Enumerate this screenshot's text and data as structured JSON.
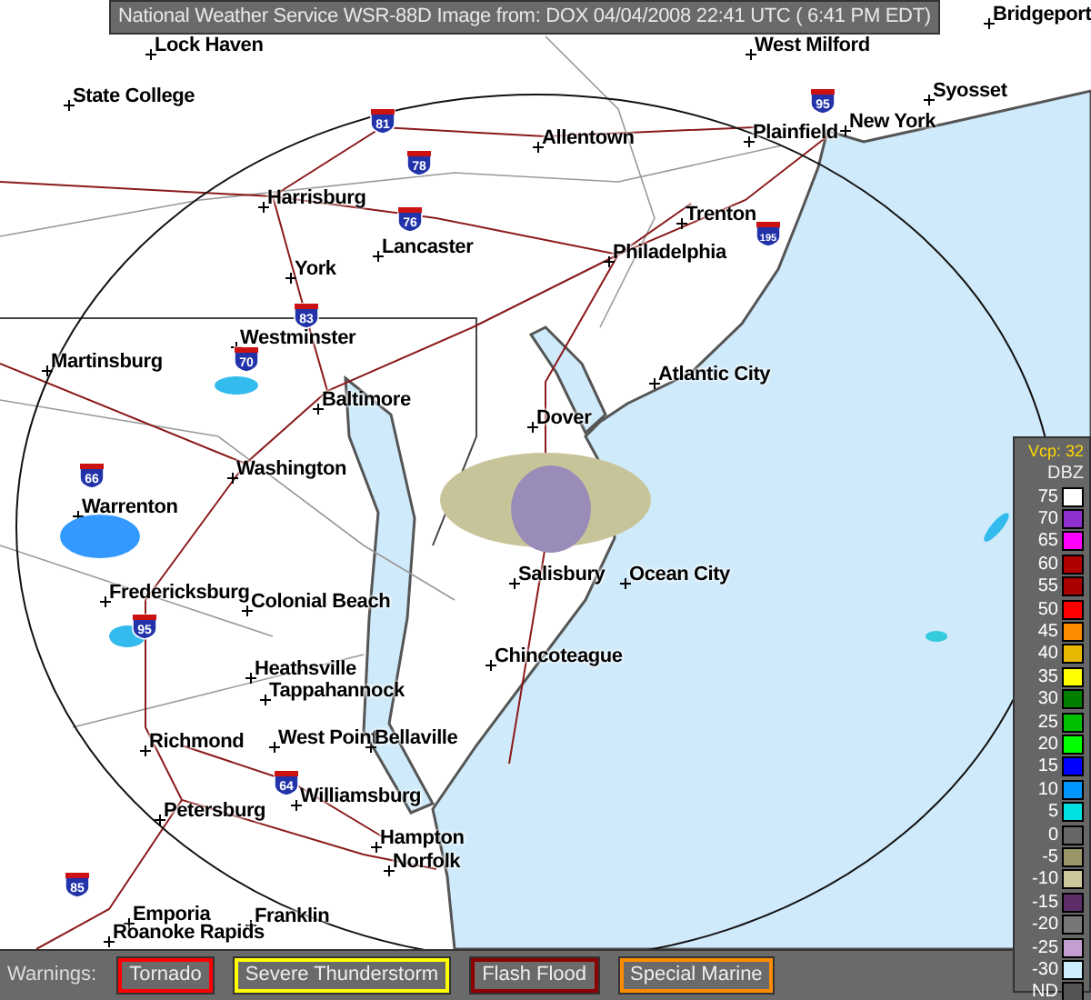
{
  "header": {
    "title": "National Weather Service WSR-88D Image from: DOX 04/04/2008 22:41 UTC ( 6:41 PM EDT)"
  },
  "map": {
    "cities": [
      {
        "name": "Lock Haven"
      },
      {
        "name": "State College"
      },
      {
        "name": "West Milford"
      },
      {
        "name": "Bridgeport"
      },
      {
        "name": "Syosset"
      },
      {
        "name": "New York"
      },
      {
        "name": "Plainfield"
      },
      {
        "name": "Allentown"
      },
      {
        "name": "Harrisburg"
      },
      {
        "name": "Trenton"
      },
      {
        "name": "Lancaster"
      },
      {
        "name": "Philadelphia"
      },
      {
        "name": "York"
      },
      {
        "name": "Westminster"
      },
      {
        "name": "Martinsburg"
      },
      {
        "name": "Baltimore"
      },
      {
        "name": "Atlantic City"
      },
      {
        "name": "Dover"
      },
      {
        "name": "Washington"
      },
      {
        "name": "Warrenton"
      },
      {
        "name": "Salisbury"
      },
      {
        "name": "Ocean City"
      },
      {
        "name": "Fredericksburg"
      },
      {
        "name": "Colonial Beach"
      },
      {
        "name": "Chincoteague"
      },
      {
        "name": "Heathsville"
      },
      {
        "name": "Tappahannock"
      },
      {
        "name": "Richmond"
      },
      {
        "name": "West Point"
      },
      {
        "name": "Bellaville"
      },
      {
        "name": "Williamsburg"
      },
      {
        "name": "Petersburg"
      },
      {
        "name": "Hampton"
      },
      {
        "name": "Norfolk"
      },
      {
        "name": "Emporia"
      },
      {
        "name": "Franklin"
      },
      {
        "name": "Roanoke Rapids"
      }
    ],
    "interstates": [
      {
        "label": "81"
      },
      {
        "label": "78"
      },
      {
        "label": "76"
      },
      {
        "label": "83"
      },
      {
        "label": "95"
      },
      {
        "label": "195"
      },
      {
        "label": "70"
      },
      {
        "label": "66"
      },
      {
        "label": "95"
      },
      {
        "label": "64"
      },
      {
        "label": "85"
      }
    ]
  },
  "legend": {
    "vcp": "Vcp: 32",
    "unit": "DBZ",
    "levels": [
      {
        "label": "75",
        "color": "#ffffff"
      },
      {
        "label": "70",
        "color": "#8e2fd0"
      },
      {
        "label": "65",
        "color": "#ff00ff"
      },
      {
        "label": "60",
        "color": "#b00000"
      },
      {
        "label": "55",
        "color": "#a80000"
      },
      {
        "label": "50",
        "color": "#ff0000"
      },
      {
        "label": "45",
        "color": "#ff8c00"
      },
      {
        "label": "40",
        "color": "#e8b800"
      },
      {
        "label": "35",
        "color": "#ffff00"
      },
      {
        "label": "30",
        "color": "#008000"
      },
      {
        "label": "25",
        "color": "#00c000"
      },
      {
        "label": "20",
        "color": "#00ff00"
      },
      {
        "label": "15",
        "color": "#0000ff"
      },
      {
        "label": "10",
        "color": "#0096ff"
      },
      {
        "label": "5",
        "color": "#00e0e0"
      },
      {
        "label": "0",
        "color": "#666666"
      },
      {
        "label": "-5",
        "color": "#9a9668"
      },
      {
        "label": "-10",
        "color": "#ccc89c"
      },
      {
        "label": "-15",
        "color": "#5e2e6a"
      },
      {
        "label": "-20",
        "color": "#777777"
      },
      {
        "label": "-25",
        "color": "#c39fd1"
      },
      {
        "label": "-30",
        "color": "#cceeff"
      },
      {
        "label": "ND",
        "color": "#555555"
      }
    ]
  },
  "warnings": {
    "label": "Warnings:",
    "types": [
      {
        "label": "Tornado",
        "color": "#ff0000"
      },
      {
        "label": "Severe Thunderstorm",
        "color": "#ffff00"
      },
      {
        "label": "Flash Flood",
        "color": "#8b0000"
      },
      {
        "label": "Special Marine",
        "color": "#ff8c00"
      }
    ]
  }
}
